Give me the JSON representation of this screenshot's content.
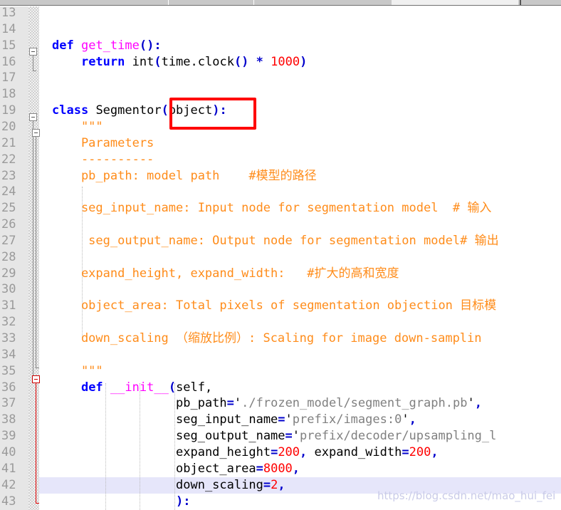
{
  "window": {
    "kind": "code-editor",
    "theme_background": "#ffffff",
    "gutter_background": "#e6e6e6",
    "line_number_color": "#9a9a9a",
    "highlight_row_color": "#e6e6fa",
    "annotation_color": "#ff0000",
    "docstring_color": "#ff8c1a",
    "keyword_color": "#0000ff",
    "number_color": "#ff0000",
    "string_color": "#808080",
    "function_color": "#ff00ff"
  },
  "gutter": {
    "line_numbers": [
      "13",
      "14",
      "15",
      "16",
      "17",
      "18",
      "19",
      "20",
      "21",
      "22",
      "23",
      "24",
      "25",
      "26",
      "27",
      "28",
      "29",
      "30",
      "31",
      "32",
      "33",
      "34",
      "35",
      "36",
      "37",
      "38",
      "39",
      "40",
      "41",
      "42",
      "43"
    ],
    "first_line": 13,
    "last_line": 43
  },
  "code": {
    "lines": [
      {
        "n": "13",
        "tokens": []
      },
      {
        "n": "14",
        "tokens": []
      },
      {
        "n": "15",
        "tokens": [
          {
            "t": "def",
            "c": "kw"
          },
          {
            "t": " ",
            "c": "plain"
          },
          {
            "t": "get_time",
            "c": "fn"
          },
          {
            "t": "()",
            "c": "punct"
          },
          {
            "t": ":",
            "c": "punct"
          }
        ]
      },
      {
        "n": "16",
        "tokens": [
          {
            "t": "    ",
            "c": "plain"
          },
          {
            "t": "return",
            "c": "kw"
          },
          {
            "t": " int",
            "c": "plain"
          },
          {
            "t": "(",
            "c": "punct"
          },
          {
            "t": "time.clock",
            "c": "plain"
          },
          {
            "t": "()",
            "c": "punct"
          },
          {
            "t": " ",
            "c": "plain"
          },
          {
            "t": "*",
            "c": "op"
          },
          {
            "t": " ",
            "c": "plain"
          },
          {
            "t": "1000",
            "c": "num"
          },
          {
            "t": ")",
            "c": "punct"
          }
        ]
      },
      {
        "n": "17",
        "tokens": []
      },
      {
        "n": "18",
        "tokens": []
      },
      {
        "n": "19",
        "tokens": [
          {
            "t": "class",
            "c": "kw"
          },
          {
            "t": " ",
            "c": "plain"
          },
          {
            "t": "Segmentor",
            "c": "plain"
          },
          {
            "t": "(",
            "c": "punct"
          },
          {
            "t": "object",
            "c": "plain"
          },
          {
            "t": ")",
            "c": "punct"
          },
          {
            "t": ":",
            "c": "punct"
          }
        ]
      },
      {
        "n": "20",
        "tokens": [
          {
            "t": "    \"\"\"",
            "c": "doc"
          }
        ]
      },
      {
        "n": "21",
        "tokens": [
          {
            "t": "    Parameters",
            "c": "doc"
          }
        ]
      },
      {
        "n": "22",
        "tokens": [
          {
            "t": "    ----------",
            "c": "doc"
          }
        ]
      },
      {
        "n": "23",
        "tokens": [
          {
            "t": "    pb_path: model path    #模型的路径",
            "c": "doc"
          }
        ]
      },
      {
        "n": "24",
        "tokens": []
      },
      {
        "n": "25",
        "tokens": [
          {
            "t": "    seg_input_name: Input node for segmentation model  # 输入",
            "c": "doc"
          }
        ]
      },
      {
        "n": "26",
        "tokens": []
      },
      {
        "n": "27",
        "tokens": [
          {
            "t": "     seg_output_name: Output node for segmentation model# 输出",
            "c": "doc"
          }
        ]
      },
      {
        "n": "28",
        "tokens": []
      },
      {
        "n": "29",
        "tokens": [
          {
            "t": "    expand_height, expand_width:   #扩大的高和宽度",
            "c": "doc"
          }
        ]
      },
      {
        "n": "30",
        "tokens": []
      },
      {
        "n": "31",
        "tokens": [
          {
            "t": "    object_area: Total pixels of segmentation objection 目标模",
            "c": "doc"
          }
        ]
      },
      {
        "n": "32",
        "tokens": []
      },
      {
        "n": "33",
        "tokens": [
          {
            "t": "    down_scaling （缩放比例）: Scaling for image down-samplin",
            "c": "doc"
          }
        ]
      },
      {
        "n": "34",
        "tokens": []
      },
      {
        "n": "35",
        "tokens": [
          {
            "t": "    \"\"\"",
            "c": "doc"
          }
        ]
      },
      {
        "n": "36",
        "tokens": [
          {
            "t": "    ",
            "c": "plain"
          },
          {
            "t": "def",
            "c": "kw"
          },
          {
            "t": " ",
            "c": "plain"
          },
          {
            "t": "__init__",
            "c": "fn"
          },
          {
            "t": "(",
            "c": "punct"
          },
          {
            "t": "self,",
            "c": "plain"
          }
        ]
      },
      {
        "n": "37",
        "tokens": [
          {
            "t": "                 ",
            "c": "plain"
          },
          {
            "t": "pb_path",
            "c": "kwarg"
          },
          {
            "t": "=",
            "c": "op"
          },
          {
            "t": "'",
            "c": "plain"
          },
          {
            "t": "./frozen_model/segment_graph.pb",
            "c": "str"
          },
          {
            "t": "'",
            "c": "plain"
          },
          {
            "t": ",",
            "c": "punct"
          }
        ]
      },
      {
        "n": "38",
        "tokens": [
          {
            "t": "                 ",
            "c": "plain"
          },
          {
            "t": "seg_input_name",
            "c": "kwarg"
          },
          {
            "t": "=",
            "c": "op"
          },
          {
            "t": "'",
            "c": "plain"
          },
          {
            "t": "prefix/images:0",
            "c": "str"
          },
          {
            "t": "'",
            "c": "plain"
          },
          {
            "t": ",",
            "c": "punct"
          }
        ]
      },
      {
        "n": "39",
        "tokens": [
          {
            "t": "                 ",
            "c": "plain"
          },
          {
            "t": "seg_output_name",
            "c": "kwarg"
          },
          {
            "t": "=",
            "c": "op"
          },
          {
            "t": "'",
            "c": "plain"
          },
          {
            "t": "prefix/decoder/upsampling_l",
            "c": "str"
          }
        ]
      },
      {
        "n": "40",
        "tokens": [
          {
            "t": "                 ",
            "c": "plain"
          },
          {
            "t": "expand_height",
            "c": "kwarg"
          },
          {
            "t": "=",
            "c": "op"
          },
          {
            "t": "200",
            "c": "num"
          },
          {
            "t": ", ",
            "c": "punct"
          },
          {
            "t": "expand_width",
            "c": "kwarg"
          },
          {
            "t": "=",
            "c": "op"
          },
          {
            "t": "200",
            "c": "num"
          },
          {
            "t": ",",
            "c": "punct"
          }
        ]
      },
      {
        "n": "41",
        "tokens": [
          {
            "t": "                 ",
            "c": "plain"
          },
          {
            "t": "object_area",
            "c": "kwarg"
          },
          {
            "t": "=",
            "c": "op"
          },
          {
            "t": "8000",
            "c": "num"
          },
          {
            "t": ",",
            "c": "punct"
          }
        ]
      },
      {
        "n": "42",
        "tokens": [
          {
            "t": "                 ",
            "c": "plain"
          },
          {
            "t": "down_scaling",
            "c": "kwarg"
          },
          {
            "t": "=",
            "c": "op"
          },
          {
            "t": "2",
            "c": "num"
          },
          {
            "t": ",",
            "c": "punct"
          }
        ]
      },
      {
        "n": "43",
        "tokens": [
          {
            "t": "                 ",
            "c": "plain"
          },
          {
            "t": ")",
            "c": "punct"
          },
          {
            "t": ":",
            "c": "punct"
          }
        ]
      }
    ],
    "highlighted_line": "42"
  },
  "fold_markers": [
    {
      "line": "15",
      "type": "collapse-box",
      "color": "#888888"
    },
    {
      "line": "19",
      "type": "collapse-box",
      "color": "#888888"
    },
    {
      "line": "20",
      "type": "collapse-box",
      "color": "#888888"
    },
    {
      "line": "36",
      "type": "collapse-box",
      "color": "#cc0000"
    }
  ],
  "annotation": {
    "shape": "rectangle",
    "color": "#ff0000",
    "encloses": "(object):",
    "line": "19"
  },
  "watermark": {
    "text": "https://blog.csdn.net/mao_hui_fei"
  },
  "statusbar": {
    "segments": [
      "",
      "",
      "",
      "",
      ""
    ]
  }
}
